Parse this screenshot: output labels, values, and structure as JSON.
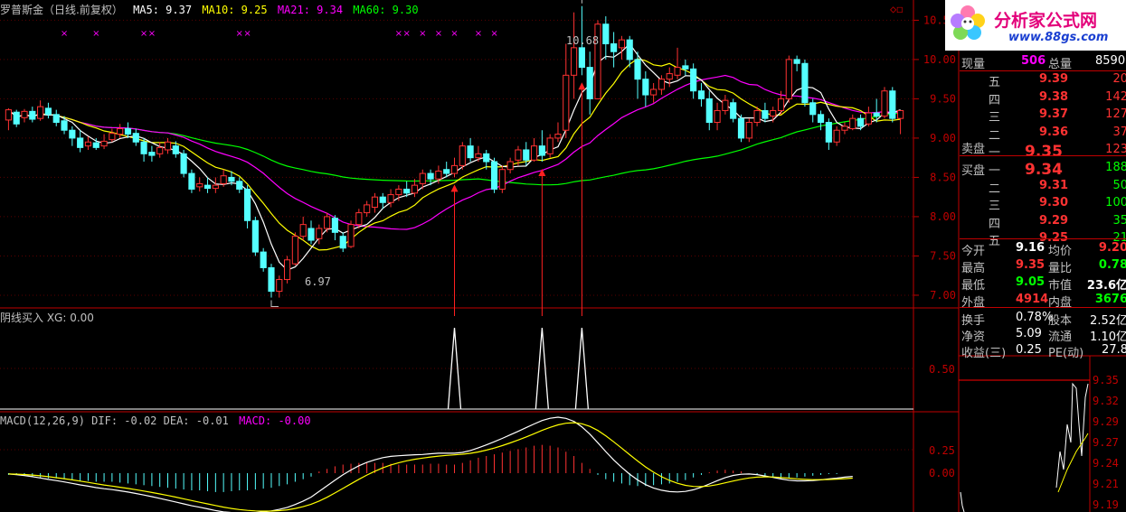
{
  "header": {
    "stock_name": "罗普斯金（日线.前复权）",
    "ma5": "MA5: 9.37",
    "ma10": "MA10: 9.25",
    "ma21": "MA21: 9.34",
    "ma60": "MA60: 9.30"
  },
  "indicator_panel": {
    "label": "阴线买入 XG: 0.00",
    "tick": "0.50"
  },
  "macd_panel": {
    "label_main": "MACD(12,26,9) DIF: -0.02 DEA: -0.01",
    "label_macd": "MACD: -0.00",
    "ticks": [
      "0.25",
      "0.00"
    ]
  },
  "price_annotations": {
    "high": "10.68",
    "low": "6.97"
  },
  "logo": {
    "title": "分析家公式网",
    "url": "www.88gs.com"
  },
  "colors": {
    "up": "#ff3232",
    "down": "#54ffff",
    "ma5": "#ffffff",
    "ma10": "#ffff00",
    "ma21": "#ff00ff",
    "ma60": "#00ff00",
    "grid": "#8b0000",
    "axis": "#c00000"
  },
  "quote": {
    "row1": {
      "l1": "现量",
      "v1": "506",
      "l2": "总量",
      "v2": "8590"
    },
    "sell": [
      {
        "level": "五",
        "price": "9.39",
        "vol": "20"
      },
      {
        "level": "四",
        "price": "9.38",
        "vol": "142"
      },
      {
        "level": "三",
        "price": "9.37",
        "vol": "127"
      },
      {
        "level": "二",
        "price": "9.36",
        "vol": "37"
      },
      {
        "level": "一",
        "price": "9.35",
        "vol": "123"
      }
    ],
    "sell_label": "卖盘",
    "buy_label": "买盘",
    "buy": [
      {
        "level": "一",
        "price": "9.34",
        "vol": "188"
      },
      {
        "level": "二",
        "price": "9.31",
        "vol": "50"
      },
      {
        "level": "三",
        "price": "9.30",
        "vol": "100"
      },
      {
        "level": "四",
        "price": "9.29",
        "vol": "35"
      },
      {
        "level": "五",
        "price": "9.25",
        "vol": "21"
      }
    ],
    "stats": [
      {
        "l1": "今开",
        "v1": "9.16",
        "l2": "均价",
        "v2": "9.20"
      },
      {
        "l1": "最高",
        "v1": "9.35",
        "l2": "量比",
        "v2": "0.78"
      },
      {
        "l1": "最低",
        "v1": "9.05",
        "l2": "市值",
        "v2": "23.6亿"
      },
      {
        "l1": "外盘",
        "v1": "4914",
        "l2": "内盘",
        "v2": "3676"
      }
    ],
    "stats2": [
      {
        "l1": "换手",
        "v1": "0.78%",
        "l2": "股本",
        "v2": "2.52亿"
      },
      {
        "l1": "净资",
        "v1": "5.09",
        "l2": "流通",
        "v2": "1.10亿"
      },
      {
        "l1": "收益(三)",
        "v1": "0.25",
        "l2": "PE(动)",
        "v2": "27.8"
      }
    ]
  },
  "intraday": {
    "ticks": [
      "9.35",
      "9.32",
      "9.29",
      "9.27",
      "9.24",
      "9.21",
      "9.19"
    ]
  },
  "chart_data": {
    "type": "candlestick",
    "y_ticks": [
      10.5,
      10.0,
      9.5,
      9.0,
      8.5,
      8.0,
      7.5,
      7.0
    ],
    "ylim": [
      6.85,
      10.7
    ],
    "candles": [
      [
        9.23,
        9.36,
        9.1,
        9.38
      ],
      [
        9.33,
        9.18,
        9.14,
        9.36
      ],
      [
        9.26,
        9.34,
        9.2,
        9.37
      ],
      [
        9.34,
        9.24,
        9.2,
        9.4
      ],
      [
        9.25,
        9.4,
        9.22,
        9.48
      ],
      [
        9.38,
        9.3,
        9.25,
        9.45
      ],
      [
        9.3,
        9.2,
        9.15,
        9.36
      ],
      [
        9.22,
        9.1,
        9.05,
        9.28
      ],
      [
        9.1,
        9.0,
        8.9,
        9.15
      ],
      [
        9.0,
        8.88,
        8.82,
        9.1
      ],
      [
        8.9,
        8.95,
        8.85,
        9.02
      ],
      [
        8.94,
        8.88,
        8.85,
        9.0
      ],
      [
        8.9,
        8.96,
        8.86,
        9.05
      ],
      [
        8.98,
        9.06,
        8.95,
        9.12
      ],
      [
        9.05,
        9.12,
        9.0,
        9.18
      ],
      [
        9.12,
        9.05,
        9.0,
        9.2
      ],
      [
        9.06,
        8.95,
        8.9,
        9.12
      ],
      [
        8.95,
        8.8,
        8.7,
        9.0
      ],
      [
        8.82,
        8.78,
        8.7,
        8.9
      ],
      [
        8.8,
        8.88,
        8.75,
        8.95
      ],
      [
        8.85,
        8.95,
        8.8,
        9.0
      ],
      [
        8.9,
        8.8,
        8.75,
        8.96
      ],
      [
        8.8,
        8.55,
        8.5,
        8.85
      ],
      [
        8.55,
        8.35,
        8.3,
        8.6
      ],
      [
        8.38,
        8.42,
        8.32,
        8.5
      ],
      [
        8.4,
        8.36,
        8.3,
        8.5
      ],
      [
        8.36,
        8.4,
        8.3,
        8.5
      ],
      [
        8.42,
        8.52,
        8.38,
        8.6
      ],
      [
        8.5,
        8.45,
        8.4,
        8.58
      ],
      [
        8.45,
        8.35,
        8.3,
        8.5
      ],
      [
        8.35,
        7.95,
        7.85,
        8.4
      ],
      [
        7.95,
        7.55,
        7.5,
        8.0
      ],
      [
        7.55,
        7.35,
        7.3,
        7.6
      ],
      [
        7.35,
        7.05,
        6.97,
        7.4
      ],
      [
        7.05,
        7.2,
        6.97,
        7.25
      ],
      [
        7.2,
        7.45,
        7.15,
        7.5
      ],
      [
        7.4,
        7.75,
        7.38,
        7.8
      ],
      [
        7.75,
        7.9,
        7.7,
        8.0
      ],
      [
        7.85,
        7.7,
        7.65,
        7.95
      ],
      [
        7.72,
        7.85,
        7.65,
        7.9
      ],
      [
        7.85,
        8.0,
        7.8,
        8.05
      ],
      [
        7.98,
        7.8,
        7.7,
        8.02
      ],
      [
        7.75,
        7.6,
        7.55,
        7.8
      ],
      [
        7.62,
        7.9,
        7.6,
        7.95
      ],
      [
        7.9,
        8.05,
        7.85,
        8.1
      ],
      [
        8.05,
        8.15,
        8.0,
        8.2
      ],
      [
        8.12,
        8.25,
        8.05,
        8.3
      ],
      [
        8.25,
        8.18,
        8.1,
        8.3
      ],
      [
        8.18,
        8.28,
        8.12,
        8.35
      ],
      [
        8.28,
        8.35,
        8.2,
        8.4
      ],
      [
        8.35,
        8.3,
        8.25,
        8.45
      ],
      [
        8.3,
        8.4,
        8.25,
        8.48
      ],
      [
        8.42,
        8.55,
        8.35,
        8.6
      ],
      [
        8.55,
        8.48,
        8.4,
        8.6
      ],
      [
        8.48,
        8.58,
        8.42,
        8.65
      ],
      [
        8.6,
        8.55,
        8.5,
        8.7
      ],
      [
        8.55,
        8.65,
        8.5,
        8.75
      ],
      [
        8.65,
        8.9,
        8.6,
        8.95
      ],
      [
        8.9,
        8.75,
        8.7,
        9.0
      ],
      [
        8.75,
        8.8,
        8.7,
        8.9
      ],
      [
        8.8,
        8.7,
        8.6,
        8.85
      ],
      [
        8.7,
        8.35,
        8.3,
        8.75
      ],
      [
        8.35,
        8.6,
        8.3,
        8.65
      ],
      [
        8.6,
        8.7,
        8.55,
        8.75
      ],
      [
        8.72,
        8.85,
        8.65,
        8.9
      ],
      [
        8.85,
        8.72,
        8.65,
        8.95
      ],
      [
        8.72,
        8.9,
        8.7,
        9.0
      ],
      [
        8.9,
        8.78,
        8.7,
        9.1
      ],
      [
        8.8,
        9.0,
        8.75,
        9.05
      ],
      [
        9.0,
        9.05,
        8.95,
        9.2
      ],
      [
        9.1,
        9.8,
        9.0,
        10.2
      ],
      [
        9.8,
        10.15,
        9.5,
        10.6
      ],
      [
        10.15,
        9.9,
        9.8,
        10.68
      ],
      [
        9.9,
        9.5,
        9.3,
        10.1
      ],
      [
        9.5,
        10.45,
        9.5,
        10.5
      ],
      [
        10.45,
        10.2,
        10.0,
        10.55
      ],
      [
        10.2,
        10.1,
        9.9,
        10.35
      ],
      [
        10.15,
        10.25,
        10.0,
        10.3
      ],
      [
        10.25,
        10.0,
        9.9,
        10.3
      ],
      [
        10.0,
        9.75,
        9.5,
        10.1
      ],
      [
        9.75,
        9.55,
        9.4,
        9.85
      ],
      [
        9.55,
        9.62,
        9.45,
        9.7
      ],
      [
        9.62,
        9.75,
        9.55,
        9.8
      ],
      [
        9.75,
        9.82,
        9.65,
        9.9
      ],
      [
        9.8,
        9.9,
        9.75,
        10.15
      ],
      [
        9.92,
        9.88,
        9.8,
        10.0
      ],
      [
        9.88,
        9.6,
        9.5,
        9.95
      ],
      [
        9.6,
        9.5,
        9.4,
        9.7
      ],
      [
        9.5,
        9.2,
        9.1,
        9.6
      ],
      [
        9.2,
        9.35,
        9.1,
        9.45
      ],
      [
        9.35,
        9.48,
        9.3,
        9.55
      ],
      [
        9.45,
        9.25,
        9.2,
        9.5
      ],
      [
        9.25,
        9.0,
        8.95,
        9.3
      ],
      [
        9.0,
        9.2,
        8.95,
        9.25
      ],
      [
        9.2,
        9.35,
        9.15,
        9.4
      ],
      [
        9.35,
        9.25,
        9.2,
        9.45
      ],
      [
        9.28,
        9.35,
        9.2,
        9.4
      ],
      [
        9.35,
        9.5,
        9.3,
        9.6
      ],
      [
        9.5,
        10.0,
        9.45,
        10.05
      ],
      [
        10.0,
        9.95,
        9.85,
        10.05
      ],
      [
        9.95,
        9.45,
        9.4,
        10.0
      ],
      [
        9.45,
        9.3,
        9.2,
        9.5
      ],
      [
        9.3,
        9.2,
        9.1,
        9.35
      ],
      [
        9.2,
        8.95,
        8.85,
        9.25
      ],
      [
        8.95,
        9.1,
        8.9,
        9.15
      ],
      [
        9.1,
        9.15,
        9.05,
        9.2
      ],
      [
        9.12,
        9.25,
        9.1,
        9.3
      ],
      [
        9.25,
        9.15,
        9.1,
        9.3
      ],
      [
        9.18,
        9.32,
        9.15,
        9.4
      ],
      [
        9.32,
        9.28,
        9.2,
        9.5
      ],
      [
        9.28,
        9.6,
        9.25,
        9.65
      ],
      [
        9.6,
        9.25,
        9.2,
        9.65
      ],
      [
        9.25,
        9.35,
        9.05,
        9.35
      ]
    ],
    "signals": [
      56,
      67,
      72
    ],
    "x_markers": [
      7,
      11,
      17,
      18,
      29,
      30,
      49,
      50,
      52,
      54,
      56,
      59,
      61
    ],
    "macd_hist": [
      -0.02,
      -0.02,
      -0.03,
      -0.04,
      -0.05,
      -0.06,
      -0.06,
      -0.07,
      -0.08,
      -0.09,
      -0.09,
      -0.1,
      -0.1,
      -0.1,
      -0.11,
      -0.12,
      -0.13,
      -0.14,
      -0.15,
      -0.16,
      -0.17,
      -0.18,
      -0.19,
      -0.2,
      -0.2,
      -0.21,
      -0.22,
      -0.22,
      -0.21,
      -0.2,
      -0.2,
      -0.19,
      -0.18,
      -0.17,
      -0.15,
      -0.13,
      -0.1,
      -0.07,
      -0.04,
      0.02,
      0.05,
      0.08,
      0.1,
      0.11,
      0.12,
      0.12,
      0.12,
      0.12,
      0.11,
      0.1,
      0.1,
      0.1,
      0.1,
      0.11,
      0.11,
      0.1,
      0.1,
      0.12,
      0.15,
      0.18,
      0.2,
      0.22,
      0.24,
      0.26,
      0.28,
      0.3,
      0.32,
      0.33,
      0.32,
      0.3,
      0.25,
      0.2,
      0.12,
      0.05,
      -0.02,
      -0.07,
      -0.1,
      -0.12,
      -0.14,
      -0.15,
      -0.15,
      -0.14,
      -0.13,
      -0.12,
      -0.1,
      -0.08,
      -0.05,
      -0.02,
      0.01,
      0.03,
      0.04,
      0.03,
      0.02,
      0.0,
      -0.02,
      -0.04,
      -0.05,
      -0.06,
      -0.06,
      -0.05,
      -0.04,
      -0.03,
      -0.02,
      -0.01,
      -0.01,
      -0.0,
      -0.0
    ]
  }
}
